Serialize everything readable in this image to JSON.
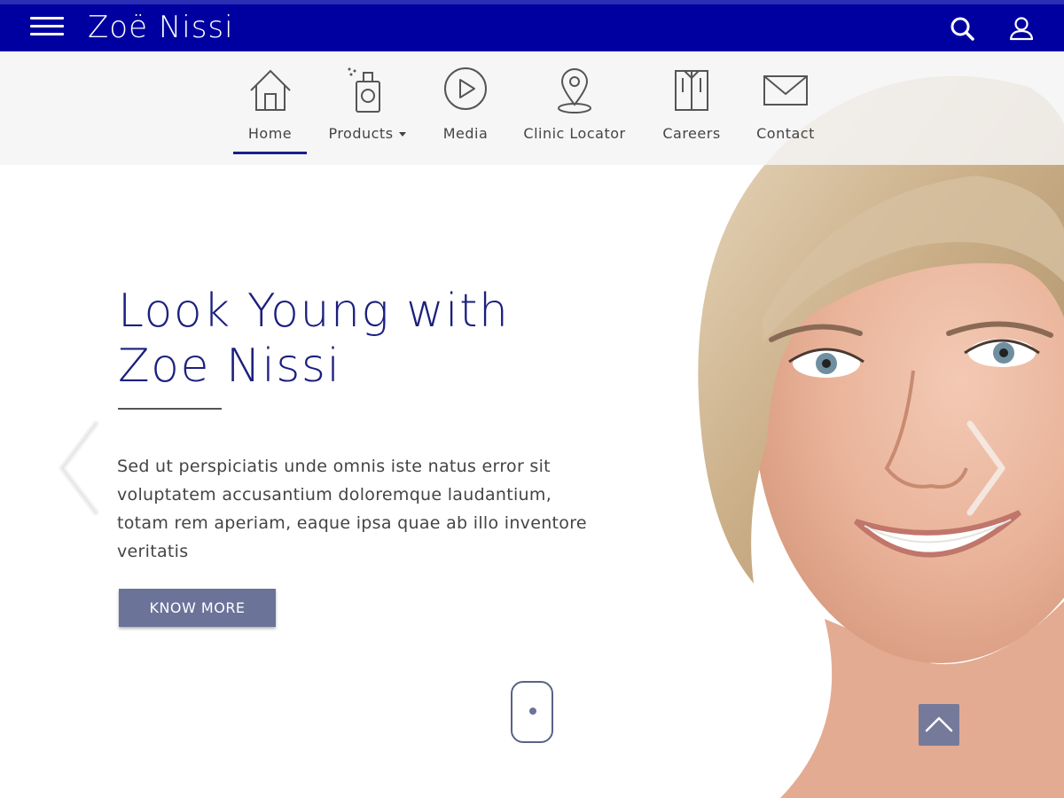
{
  "header": {
    "brand": "Zoë Nissi",
    "icons": {
      "menu": "hamburger-icon",
      "search": "search-icon",
      "account": "user-icon"
    },
    "colors": {
      "bar": "#0000a0",
      "strip": "#2a2fb4"
    }
  },
  "nav": {
    "items": [
      {
        "label": "Home",
        "icon": "home-icon",
        "active": true
      },
      {
        "label": "Products",
        "icon": "perfume-bottle-icon",
        "has_dropdown": true
      },
      {
        "label": "Media",
        "icon": "play-icon"
      },
      {
        "label": "Clinic Locator",
        "icon": "location-pin-icon"
      },
      {
        "label": "Careers",
        "icon": "shirt-icon"
      },
      {
        "label": "Contact",
        "icon": "envelope-icon"
      }
    ],
    "active_color": "#1a1d8c"
  },
  "hero": {
    "title": "Look Young with Zoe Nissi",
    "body": "Sed ut perspiciatis unde omnis iste natus error sit voluptatem accusantium doloremque laudantium, totam rem aperiam, eaque ipsa quae ab illo inventore veritatis",
    "cta_label": "KNOW MORE",
    "title_color": "#1b1f7e",
    "cta_color": "#6b7399"
  },
  "carousel": {
    "prev_icon": "chevron-left-icon",
    "next_icon": "chevron-right-icon"
  },
  "scroll": {
    "icon": "mouse-scroll-icon"
  },
  "to_top": {
    "icon": "chevron-up-icon"
  }
}
